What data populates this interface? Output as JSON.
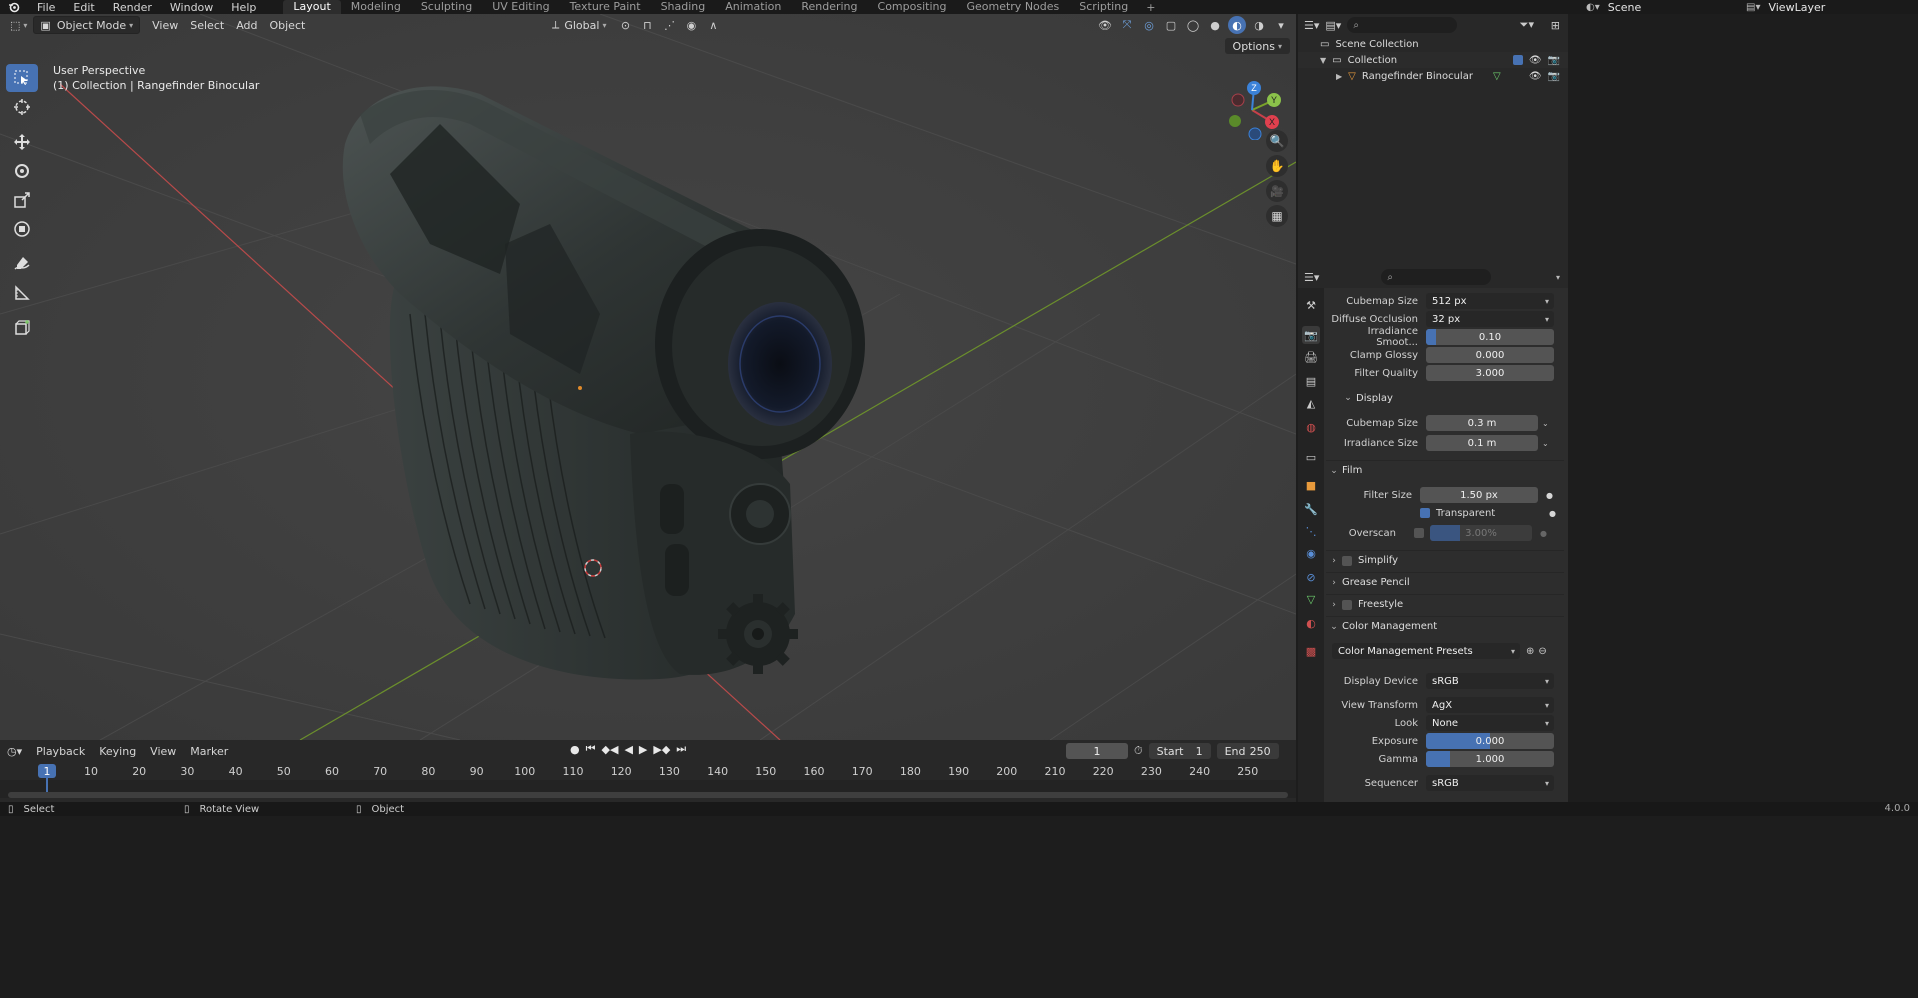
{
  "topbar": {
    "menus": [
      "File",
      "Edit",
      "Render",
      "Window",
      "Help"
    ],
    "workspaces": [
      "Layout",
      "Modeling",
      "Sculpting",
      "UV Editing",
      "Texture Paint",
      "Shading",
      "Animation",
      "Rendering",
      "Compositing",
      "Geometry Nodes",
      "Scripting"
    ],
    "active_workspace": "Layout",
    "scene": "Scene",
    "view_layer": "ViewLayer"
  },
  "viewport": {
    "mode": "Object Mode",
    "menus": [
      "View",
      "Select",
      "Add",
      "Object"
    ],
    "orientation": "Global",
    "options_label": "Options",
    "overlay_line1": "User Perspective",
    "overlay_line2": "(1) Collection | Rangefinder Binocular",
    "gizmo_axes": {
      "x": "X",
      "y": "Y",
      "z": "Z"
    }
  },
  "timeline": {
    "menus": [
      "Playback",
      "Keying",
      "View",
      "Marker"
    ],
    "current_frame": "1",
    "start_label": "Start",
    "start": "1",
    "end_label": "End",
    "end": "250",
    "ruler": [
      "10",
      "20",
      "30",
      "40",
      "50",
      "60",
      "70",
      "80",
      "90",
      "100",
      "110",
      "120",
      "130",
      "140",
      "150",
      "160",
      "170",
      "180",
      "190",
      "200",
      "210",
      "220",
      "230",
      "240",
      "250"
    ],
    "indicator": "1"
  },
  "status": {
    "select": "Select",
    "rotate": "Rotate View",
    "object": "Object",
    "version": "4.0.0"
  },
  "outliner": {
    "scene_collection": "Scene Collection",
    "collection": "Collection",
    "object": "Rangefinder Binocular"
  },
  "properties": {
    "cubemap_size_label": "Cubemap Size",
    "cubemap_size": "512 px",
    "diffuse_occlusion_label": "Diffuse Occlusion",
    "diffuse_occlusion": "32 px",
    "irradiance_smooth_label": "Irradiance Smoot...",
    "irradiance_smooth": "0.10",
    "clamp_glossy_label": "Clamp Glossy",
    "clamp_glossy": "0.000",
    "filter_quality_label": "Filter Quality",
    "filter_quality": "3.000",
    "display_section": "Display",
    "display_cubemap_label": "Cubemap Size",
    "display_cubemap": "0.3 m",
    "display_irradiance_label": "Irradiance Size",
    "display_irradiance": "0.1 m",
    "film_section": "Film",
    "filter_size_label": "Filter Size",
    "filter_size": "1.50 px",
    "transparent_label": "Transparent",
    "overscan_label": "Overscan",
    "overscan": "3.00%",
    "simplify_section": "Simplify",
    "grease_pencil_section": "Grease Pencil",
    "freestyle_section": "Freestyle",
    "color_management_section": "Color Management",
    "cm_presets": "Color Management Presets",
    "display_device_label": "Display Device",
    "display_device": "sRGB",
    "view_transform_label": "View Transform",
    "view_transform": "AgX",
    "look_label": "Look",
    "look": "None",
    "exposure_label": "Exposure",
    "exposure": "0.000",
    "gamma_label": "Gamma",
    "gamma": "1.000",
    "sequencer_label": "Sequencer",
    "sequencer": "sRGB"
  },
  "colors": {
    "accent": "#4772b3",
    "viewport_bg": "#3d3d3d",
    "x_axis": "#d6404a",
    "y_axis": "#7aa22a"
  }
}
